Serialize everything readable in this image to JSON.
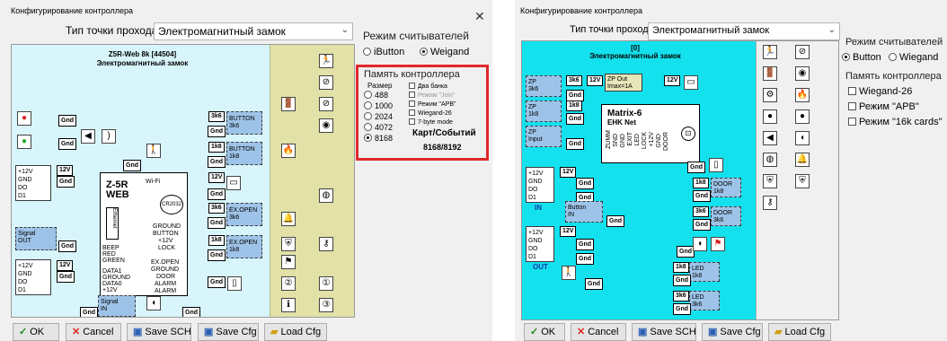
{
  "left": {
    "title": "Конфигурирование контроллера",
    "close": "✕",
    "passage_label": "Тип точки прохода",
    "passage_value": "Электромагнитный замок",
    "device_title": "Z5R-Web 8k [44504]",
    "device_subtitle": "Электромагнитный замок",
    "board_name": "Z-5R\nWEB",
    "wifi": "Wi-Fi",
    "cr2032": "CR2032",
    "ethernet": "Ethernet",
    "pins_left": [
      "BEEP",
      "RED",
      "GREEN",
      "DATA1",
      "GROUND",
      "DATA0",
      "+12V"
    ],
    "pins_right": [
      "GROUND",
      "BUTTON",
      "+12V",
      "LOCK",
      "EX.OPEN",
      "GROUND",
      "DOOR",
      "ALARM",
      "ALARM"
    ],
    "reader1_pins": [
      "+12V",
      "GND",
      "DO",
      "D1"
    ],
    "reader2_pins": [
      "+12V",
      "GND",
      "DO",
      "D1"
    ],
    "signal_out": "Signal\nOUT",
    "signal_in": "Signal\nIN",
    "tag_12v": "12V",
    "gnd": "Gnd",
    "button_blocks": [
      {
        "tag": "3k6",
        "label": "BUTTON\n3k6"
      },
      {
        "tag": "1k8",
        "label": "BUTTON\n1k8"
      },
      {
        "tag": "3k6",
        "label": "EX.OPEN\n3k6"
      },
      {
        "tag": "1k8",
        "label": "EX.OPEN\n1k8"
      }
    ],
    "reader_mode_title": "Режим считывателей",
    "reader_modes": [
      "iButton",
      "Weigand"
    ],
    "reader_mode_selected": "Weigand",
    "memory_title": "Память контроллера",
    "size_label": "Размер",
    "sizes": [
      "488",
      "1000",
      "2024",
      "4072",
      "8168"
    ],
    "size_selected": "8168",
    "options": [
      "Два банка",
      "Режим \"Join\"",
      "Режим \"APB\"",
      "Wiegand-26",
      "7-byte mode"
    ],
    "cards_events_label": "Карт/Событий",
    "cards_events_value": "8168/8192",
    "buttons": {
      "ok": "OK",
      "cancel": "Cancel",
      "save_sch": "Save SCH",
      "save_cfg": "Save Cfg",
      "load_cfg": "Load Cfg"
    }
  },
  "right": {
    "title": "Конфигурирование контроллера",
    "passage_label": "Тип точки прохода",
    "passage_value": "Электромагнитный замок",
    "device_title": "[0]",
    "device_subtitle": "Электромагнитный замок",
    "board_name": "Matrix-6",
    "board_sub": "EHK Net",
    "board_pins": [
      "ZUMM",
      "SND",
      "GND",
      "EXIT",
      "LED",
      "LOCK",
      "+12V",
      "GND",
      "DOOR"
    ],
    "zp_blocks": [
      {
        "tag": "3k6",
        "label": "ZP\n3k6"
      },
      {
        "tag": "1k8",
        "label": "ZP\n1k8"
      },
      {
        "tag": "",
        "label": "ZP\nInput"
      }
    ],
    "zp_out": "ZP Out\nImax=1A",
    "tag_12v": "12V",
    "gnd": "Gnd",
    "reader_pins": [
      "+12V",
      "GND",
      "DO",
      "D1"
    ],
    "reader_in": "IN",
    "reader_out": "OUT",
    "button_in": "Button\nIN",
    "door_blocks": [
      {
        "tag": "1k8",
        "label": "DOOR\n1k8"
      },
      {
        "tag": "3k6",
        "label": "DOOR\n3k6"
      }
    ],
    "led_blocks": [
      {
        "tag": "1k8",
        "label": "LED\n1k8"
      },
      {
        "tag": "3k6",
        "label": "LED\n3k6"
      }
    ],
    "reader_mode_title": "Режим считывателей",
    "reader_modes": [
      "Button",
      "Wiegand"
    ],
    "reader_mode_selected": "Button",
    "memory_title": "Память контроллера",
    "options": [
      "Wiegand-26",
      "Режим \"APB\"",
      "Режим \"16k cards\""
    ],
    "buttons": {
      "ok": "OK",
      "cancel": "Cancel",
      "save_sch": "Save SCH",
      "save_cfg": "Save Cfg",
      "load_cfg": "Load Cfg"
    }
  },
  "colors": {
    "left_diagram_bg": "#d7f5fb",
    "right_diagram_bg": "#14e1ee",
    "yellow_column": "#e1e1a8",
    "highlight_border": "#e0282a",
    "block_blue": "#9ec3e8"
  },
  "icons": [
    "running-man-icon",
    "no-entry-icon",
    "door-icon",
    "lock-icon",
    "speaker-icon",
    "led-icon",
    "fire-icon",
    "bell-icon",
    "key-icon",
    "shield-icon",
    "info-icon",
    "ok-check-icon",
    "cancel-x-icon",
    "save-icon",
    "load-folder-icon"
  ]
}
